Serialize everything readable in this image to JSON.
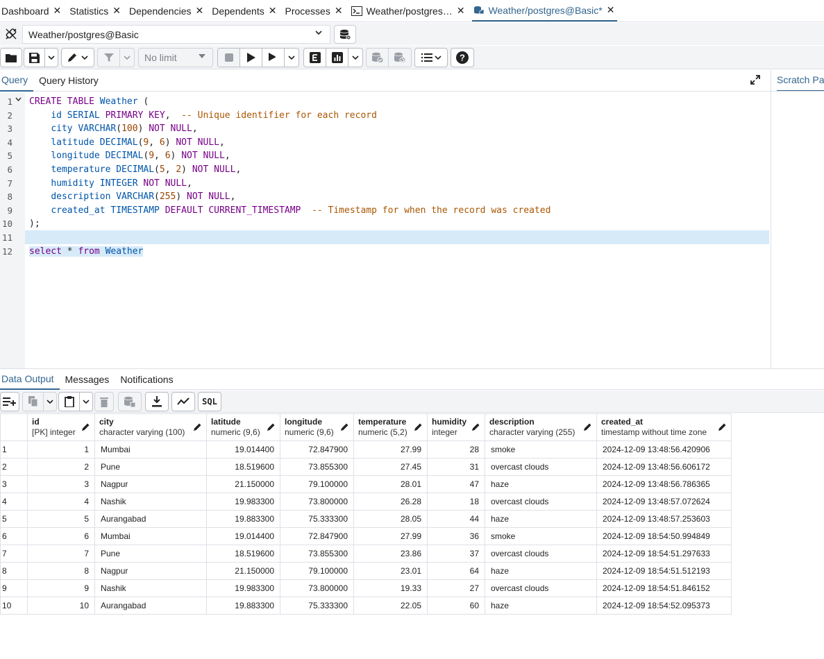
{
  "tabs": [
    {
      "label": "Dashboard"
    },
    {
      "label": "Statistics"
    },
    {
      "label": "Dependencies"
    },
    {
      "label": "Dependents"
    },
    {
      "label": "Processes"
    },
    {
      "label": "Weather/postgres…"
    },
    {
      "label": "Weather/postgres@Basic*"
    }
  ],
  "connection": {
    "value": "Weather/postgres@Basic"
  },
  "toolbar": {
    "limit": "No limit"
  },
  "query_tabs": {
    "query": "Query",
    "history": "Query History"
  },
  "scratch_pad": "Scratch Pa",
  "editor": {
    "lines": [
      "1",
      "2",
      "3",
      "4",
      "5",
      "6",
      "7",
      "8",
      "9",
      "10",
      "11",
      "12"
    ]
  },
  "output_tabs": {
    "data_output": "Data Output",
    "messages": "Messages",
    "notifications": "Notifications"
  },
  "sql_button": "SQL",
  "columns": [
    {
      "name": "id",
      "type": "[PK] integer"
    },
    {
      "name": "city",
      "type": "character varying (100)"
    },
    {
      "name": "latitude",
      "type": "numeric (9,6)"
    },
    {
      "name": "longitude",
      "type": "numeric (9,6)"
    },
    {
      "name": "temperature",
      "type": "numeric (5,2)"
    },
    {
      "name": "humidity",
      "type": "integer"
    },
    {
      "name": "description",
      "type": "character varying (255)"
    },
    {
      "name": "created_at",
      "type": "timestamp without time zone"
    }
  ],
  "rows": [
    {
      "rn": "1",
      "id": "1",
      "city": "Mumbai",
      "lat": "19.014400",
      "lon": "72.847900",
      "temp": "27.99",
      "hum": "28",
      "desc": "smoke",
      "ts": "2024-12-09 13:48:56.420906"
    },
    {
      "rn": "2",
      "id": "2",
      "city": "Pune",
      "lat": "18.519600",
      "lon": "73.855300",
      "temp": "27.45",
      "hum": "31",
      "desc": "overcast clouds",
      "ts": "2024-12-09 13:48:56.606172"
    },
    {
      "rn": "3",
      "id": "3",
      "city": "Nagpur",
      "lat": "21.150000",
      "lon": "79.100000",
      "temp": "28.01",
      "hum": "47",
      "desc": "haze",
      "ts": "2024-12-09 13:48:56.786365"
    },
    {
      "rn": "4",
      "id": "4",
      "city": "Nashik",
      "lat": "19.983300",
      "lon": "73.800000",
      "temp": "26.28",
      "hum": "18",
      "desc": "overcast clouds",
      "ts": "2024-12-09 13:48:57.072624"
    },
    {
      "rn": "5",
      "id": "5",
      "city": "Aurangabad",
      "lat": "19.883300",
      "lon": "75.333300",
      "temp": "28.05",
      "hum": "44",
      "desc": "haze",
      "ts": "2024-12-09 13:48:57.253603"
    },
    {
      "rn": "6",
      "id": "6",
      "city": "Mumbai",
      "lat": "19.014400",
      "lon": "72.847900",
      "temp": "27.99",
      "hum": "36",
      "desc": "smoke",
      "ts": "2024-12-09 18:54:50.994849"
    },
    {
      "rn": "7",
      "id": "7",
      "city": "Pune",
      "lat": "18.519600",
      "lon": "73.855300",
      "temp": "23.86",
      "hum": "37",
      "desc": "overcast clouds",
      "ts": "2024-12-09 18:54:51.297633"
    },
    {
      "rn": "8",
      "id": "8",
      "city": "Nagpur",
      "lat": "21.150000",
      "lon": "79.100000",
      "temp": "23.01",
      "hum": "64",
      "desc": "haze",
      "ts": "2024-12-09 18:54:51.512193"
    },
    {
      "rn": "9",
      "id": "9",
      "city": "Nashik",
      "lat": "19.983300",
      "lon": "73.800000",
      "temp": "19.33",
      "hum": "27",
      "desc": "overcast clouds",
      "ts": "2024-12-09 18:54:51.846152"
    },
    {
      "rn": "10",
      "id": "10",
      "city": "Aurangabad",
      "lat": "19.883300",
      "lon": "75.333300",
      "temp": "22.05",
      "hum": "60",
      "desc": "haze",
      "ts": "2024-12-09 18:54:52.095373"
    }
  ],
  "sql": {
    "l1_a": "CREATE",
    "l1_b": "TABLE",
    "l1_c": "Weather",
    "l1_d": " (",
    "l2_a": "id",
    "l2_b": "SERIAL",
    "l2_c": "PRIMARY KEY",
    "l2_d": ",  ",
    "l2_e": "-- Unique identifier for each record",
    "l3_a": "city",
    "l3_b": "VARCHAR",
    "l3_c": "100",
    "l3_d": "NOT NULL",
    "l4_a": "latitude",
    "l4_b": "DECIMAL",
    "l4_c": "9",
    "l4_d": "6",
    "l4_e": "NOT NULL",
    "l5_a": "longitude",
    "l5_b": "DECIMAL",
    "l5_c": "9",
    "l5_d": "6",
    "l5_e": "NOT NULL",
    "l6_a": "temperature",
    "l6_b": "DECIMAL",
    "l6_c": "5",
    "l6_d": "2",
    "l6_e": "NOT NULL",
    "l7_a": "humidity",
    "l7_b": "INTEGER",
    "l7_c": "NOT NULL",
    "l8_a": "description",
    "l8_b": "VARCHAR",
    "l8_c": "255",
    "l8_d": "NOT NULL",
    "l9_a": "created_at",
    "l9_b": "TIMESTAMP",
    "l9_c": "DEFAULT",
    "l9_d": "CURRENT_TIMESTAMP",
    "l9_e": "-- Timestamp for when the record was created",
    "l10": ");",
    "l12_a": "select",
    "l12_b": " * ",
    "l12_c": "from",
    "l12_d": "Weather"
  }
}
